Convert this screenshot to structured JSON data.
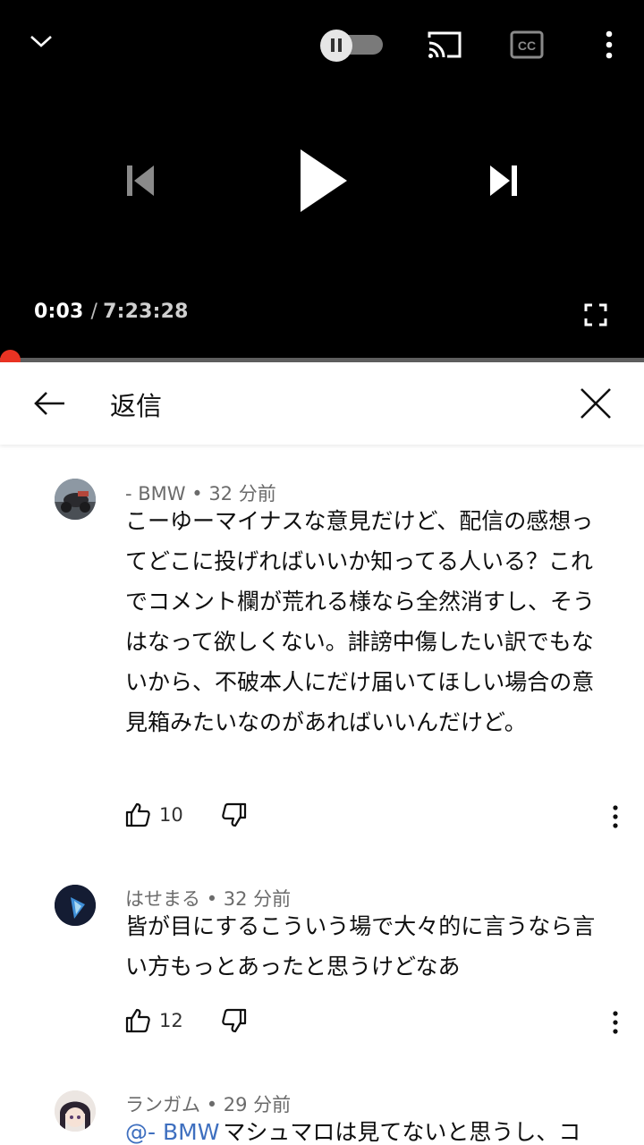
{
  "player": {
    "current_time": "0:03",
    "separator": "/",
    "duration": "7:23:28",
    "progress": 0.0001,
    "autoplay_on": false,
    "icons": {
      "collapse": "chevron-down-icon",
      "autoplay": "autoplay-toggle-icon",
      "cast": "cast-icon",
      "captions": "captions-icon",
      "more": "more-vert-icon",
      "previous": "skip-previous-icon",
      "play": "play-icon",
      "next": "skip-next-icon",
      "fullscreen": "fullscreen-icon"
    }
  },
  "reply_panel": {
    "title": "返信",
    "back_icon": "arrow-back-icon",
    "close_icon": "close-icon"
  },
  "comments": [
    {
      "author": "- BMW",
      "age": "32 分前",
      "mention": "",
      "text": "こーゆーマイナスな意見だけど、配信の感想ってどこに投げればいいか知ってる人いる？これでコメント欄が荒れる様なら全然消すし、そうはなって欲しくない。誹謗中傷したい訳でもないから、不破本人にだけ届いてほしい場合の意見箱みたいなのがあればいいんだけど。",
      "likes": "10"
    },
    {
      "author": "はせまる",
      "age": "32 分前",
      "mention": "",
      "text": "皆が目にするこういう場で大々的に言うなら言い方もっとあったと思うけどなあ",
      "likes": "12"
    },
    {
      "author": "ランガム",
      "age": "29 分前",
      "mention": "@- BMW",
      "text": "マシュマロは見てないと思うし、コ",
      "likes": ""
    }
  ],
  "meta_separator": "•",
  "colors": {
    "progress": "#ff0000",
    "mention": "#3e6fbf",
    "meta": "#6b6b6b"
  }
}
